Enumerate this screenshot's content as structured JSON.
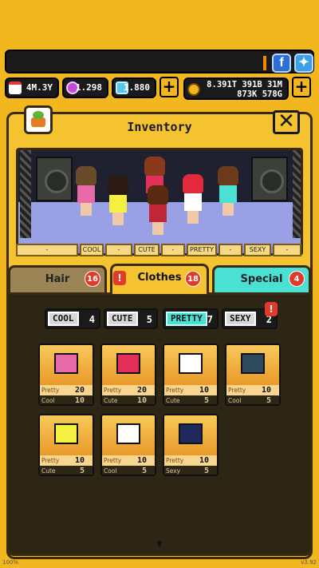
{
  "resources": {
    "days": "4M.3Y",
    "gems": "1.298",
    "tickets": "1.880",
    "money_line1": "8.391T 391B 31M",
    "money_line2": "873K 578G"
  },
  "header": {
    "title": "Inventory"
  },
  "stage_tags": [
    "-",
    "COOL",
    "-",
    "CUTE",
    "-",
    "PRETTY",
    "-",
    "SEXY",
    "-"
  ],
  "tabs": [
    {
      "label": "Hair",
      "count": "16",
      "color": "#9b8456"
    },
    {
      "label": "Clothes",
      "count": "18",
      "color": "#f6c330"
    },
    {
      "label": "Special",
      "count": "4",
      "color": "#4ae0d4"
    }
  ],
  "filters": [
    {
      "label": "COOL",
      "count": "4"
    },
    {
      "label": "CUTE",
      "count": "5"
    },
    {
      "label": "PRETTY",
      "count": "7"
    },
    {
      "label": "SEXY",
      "count": "2"
    }
  ],
  "items": [
    {
      "stat1": "Pretty",
      "val1": "20",
      "stat2": "Cool",
      "val2": "10",
      "color": "#e86aa8"
    },
    {
      "stat1": "Pretty",
      "val1": "20",
      "stat2": "Cute",
      "val2": "10",
      "color": "#e2305a"
    },
    {
      "stat1": "Pretty",
      "val1": "10",
      "stat2": "Cute",
      "val2": "5",
      "color": "#ffffff"
    },
    {
      "stat1": "Pretty",
      "val1": "10",
      "stat2": "Cool",
      "val2": "5",
      "color": "#2f4a5a"
    },
    {
      "stat1": "Pretty",
      "val1": "10",
      "stat2": "Cute",
      "val2": "5",
      "color": "#f4f040"
    },
    {
      "stat1": "Pretty",
      "val1": "10",
      "stat2": "Cool",
      "val2": "5",
      "color": "#ffffff"
    },
    {
      "stat1": "Pretty",
      "val1": "10",
      "stat2": "Sexy",
      "val2": "5",
      "color": "#1f2a5a"
    }
  ],
  "footer": {
    "percent": "100%",
    "version": "v3.92"
  }
}
